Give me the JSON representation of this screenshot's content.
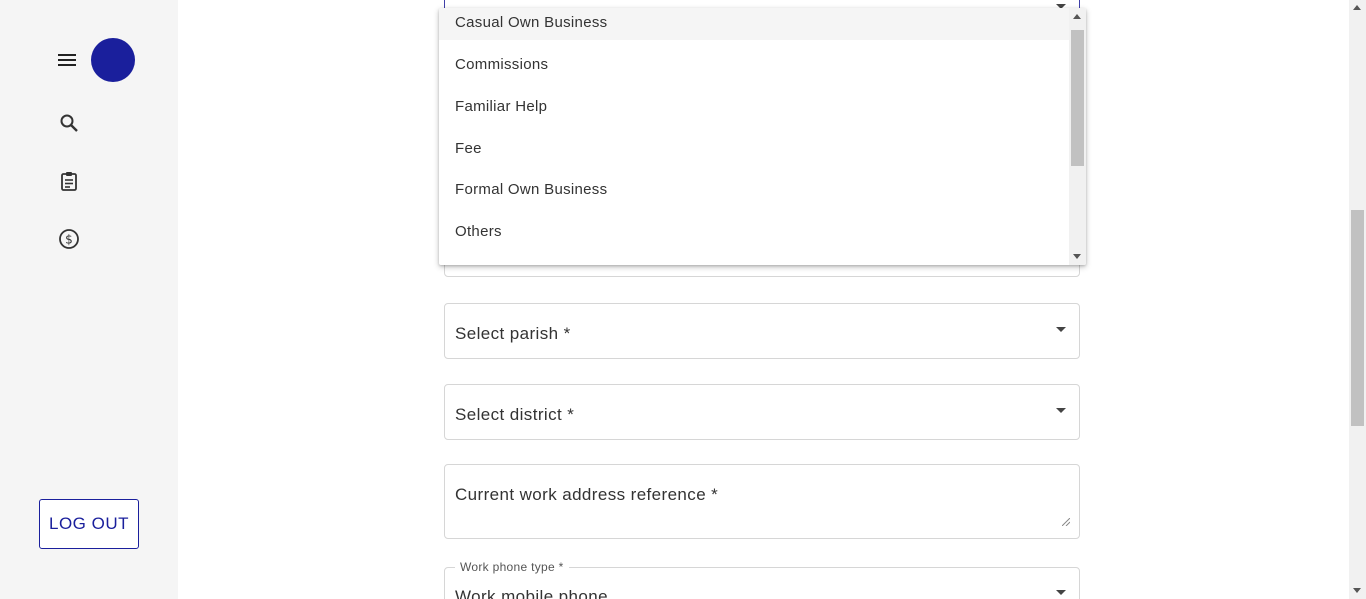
{
  "sidebar": {
    "icons": [
      "menu-icon",
      "search-icon",
      "clipboard-icon",
      "dollar-circle-icon"
    ],
    "logout_label": "LOG OUT",
    "accent_color": "#1a1f9c"
  },
  "dropdown": {
    "options": [
      {
        "label": "Casual Own Business"
      },
      {
        "label": "Commissions"
      },
      {
        "label": "Familiar Help"
      },
      {
        "label": "Fee"
      },
      {
        "label": "Formal Own Business"
      },
      {
        "label": "Others"
      }
    ]
  },
  "form": {
    "parish_placeholder": "Select parish *",
    "district_placeholder": "Select district *",
    "address_placeholder": "Current work address reference *",
    "phone_type_label": "Work phone type *",
    "phone_type_value": "Work mobile phone"
  }
}
